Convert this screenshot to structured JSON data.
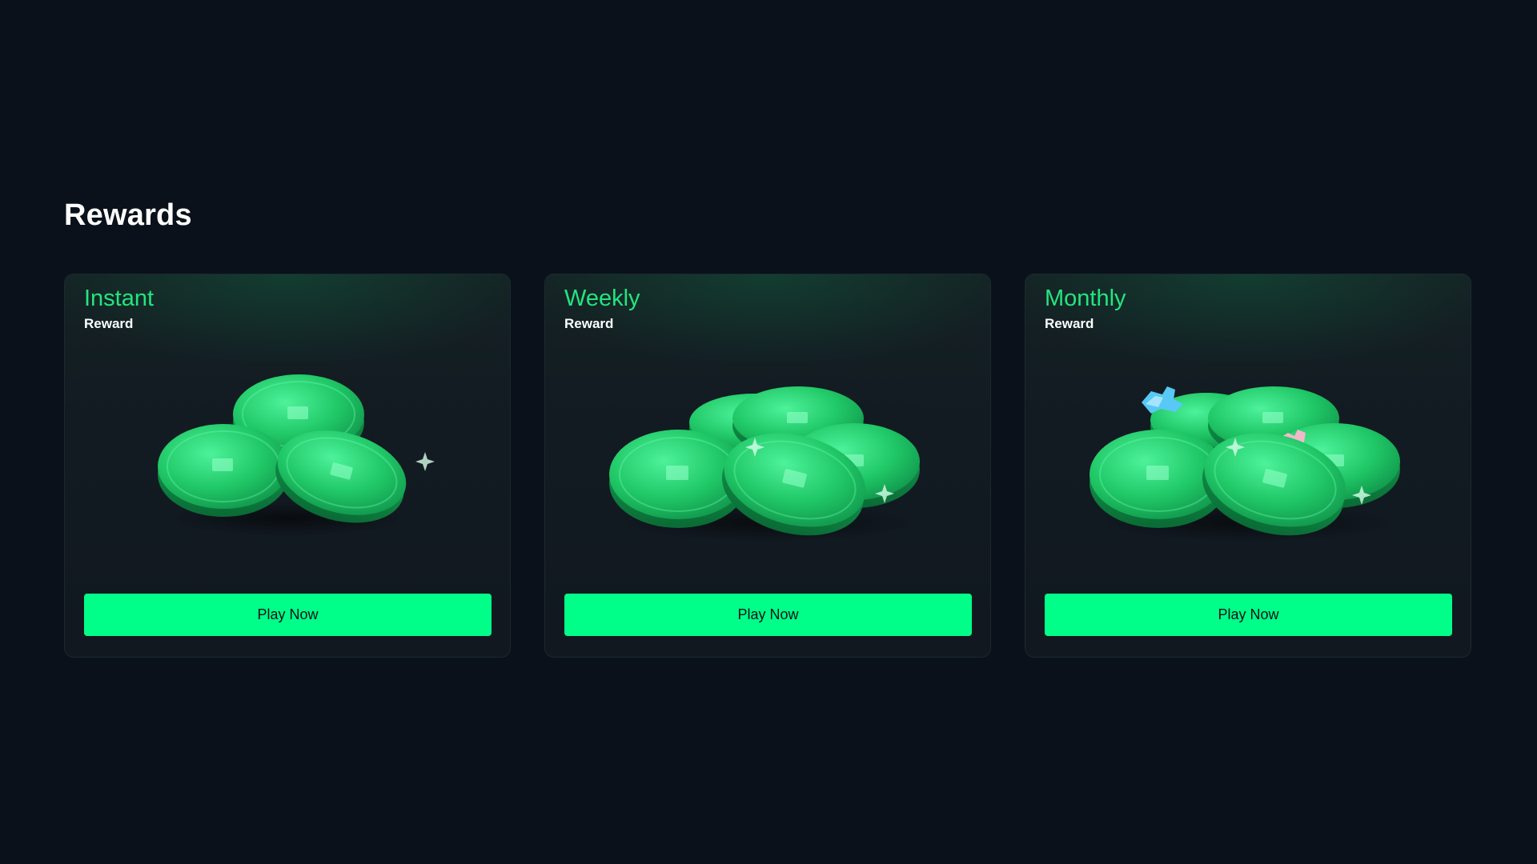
{
  "section": {
    "title": "Rewards"
  },
  "cards": [
    {
      "title": "Instant",
      "subtitle": "Reward",
      "button_label": "Play Now",
      "icon": "coin-stack-icon"
    },
    {
      "title": "Weekly",
      "subtitle": "Reward",
      "button_label": "Play Now",
      "icon": "coin-pile-icon"
    },
    {
      "title": "Monthly",
      "subtitle": "Reward",
      "button_label": "Play Now",
      "icon": "coin-pile-with-gems-icon"
    }
  ],
  "colors": {
    "background": "#0b111a",
    "accent": "#00ff88",
    "title_green": "#22e57f"
  }
}
